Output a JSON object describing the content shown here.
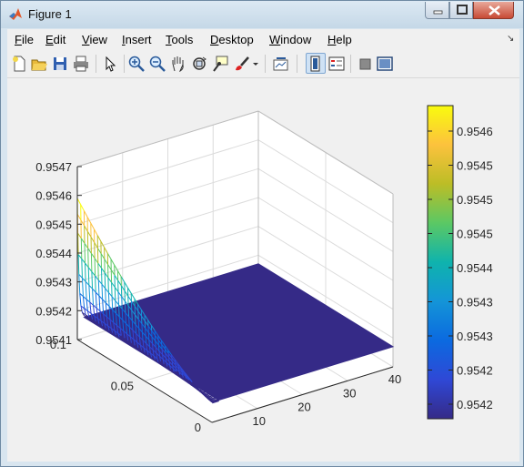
{
  "window": {
    "title": "Figure 1"
  },
  "menu": [
    {
      "name": "menu-file",
      "acc": "F",
      "rest": "ile"
    },
    {
      "name": "menu-edit",
      "acc": "E",
      "rest": "dit"
    },
    {
      "name": "menu-view",
      "acc": "V",
      "rest": "iew"
    },
    {
      "name": "menu-insert",
      "acc": "I",
      "rest": "nsert"
    },
    {
      "name": "menu-tools",
      "acc": "T",
      "rest": "ools"
    },
    {
      "name": "menu-desktop",
      "acc": "D",
      "rest": "esktop"
    },
    {
      "name": "menu-window",
      "acc": "W",
      "rest": "indow"
    },
    {
      "name": "menu-help",
      "acc": "H",
      "rest": "elp"
    }
  ],
  "toolbar_icons": [
    "new-figure-icon",
    "open-file-icon",
    "save-icon",
    "print-icon",
    "pointer-icon",
    "zoom-in-icon",
    "zoom-out-icon",
    "pan-icon",
    "rotate-3d-icon",
    "data-cursor-icon",
    "brush-icon",
    "brush-dropdown-icon",
    "link-plot-icon",
    "colorbar-icon",
    "legend-icon",
    "hide-plot-tools-icon",
    "show-plot-tools-icon"
  ],
  "chart_data": {
    "type": "surface",
    "z_ticks": [
      "0.9541",
      "0.9542",
      "0.9543",
      "0.9544",
      "0.9545",
      "0.9546",
      "0.9547"
    ],
    "z_range": [
      0.9541,
      0.9547
    ],
    "y_ticks": [
      "0",
      "0.05",
      "0.1"
    ],
    "y_range": [
      0,
      0.1
    ],
    "x_ticks": [
      "10",
      "20",
      "30",
      "40"
    ],
    "x_range": [
      0,
      40
    ],
    "surface_description_values": {
      "z_at_x0_y_max": 0.95459,
      "z_at_x0_y_mid": 0.95424,
      "z_floor": 0.95417
    },
    "grid": true,
    "colorbar": {
      "colormap": "parula",
      "ticks": [
        "0.9546",
        "0.9545",
        "0.9545",
        "0.9545",
        "0.9544",
        "0.9543",
        "0.9543",
        "0.9542",
        "0.9542"
      ],
      "colors": [
        "#f9fb0e",
        "#fcc23d",
        "#bcbd26",
        "#5bc864",
        "#0fb3ad",
        "#1495d7",
        "#0b6ae0",
        "#2f48d6",
        "#352a87"
      ]
    }
  }
}
